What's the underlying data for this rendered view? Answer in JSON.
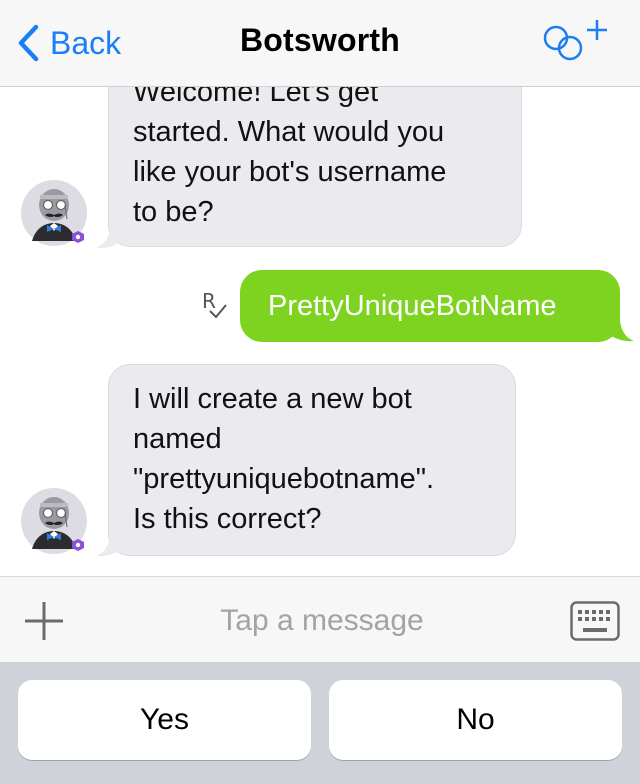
{
  "nav": {
    "back_label": "Back",
    "title": "Botsworth",
    "accent_color": "#1b7ef5"
  },
  "messages": [
    {
      "sender": "Botsworth",
      "lines": [
        "Welcome! Let's get",
        "started. What would you",
        "like your bot's username",
        "to be?"
      ]
    },
    {
      "sender": "me",
      "text": "PrettyUniqueBotName",
      "status_icon": "read-receipt-icon"
    },
    {
      "sender": "Botsworth",
      "lines": [
        "I will create a new bot",
        "named",
        "\"prettyuniquebotname\".",
        "Is this correct?"
      ]
    }
  ],
  "composer": {
    "placeholder": "Tap a message",
    "value": "",
    "left_icon": "plus-icon",
    "right_icon": "keyboard-icon"
  },
  "suggested_responses": [
    "Yes",
    "No"
  ],
  "colors": {
    "outgoing_bubble": "#7ed321",
    "incoming_bubble": "#ebebef",
    "bot_badge": "#8b4fd8"
  }
}
